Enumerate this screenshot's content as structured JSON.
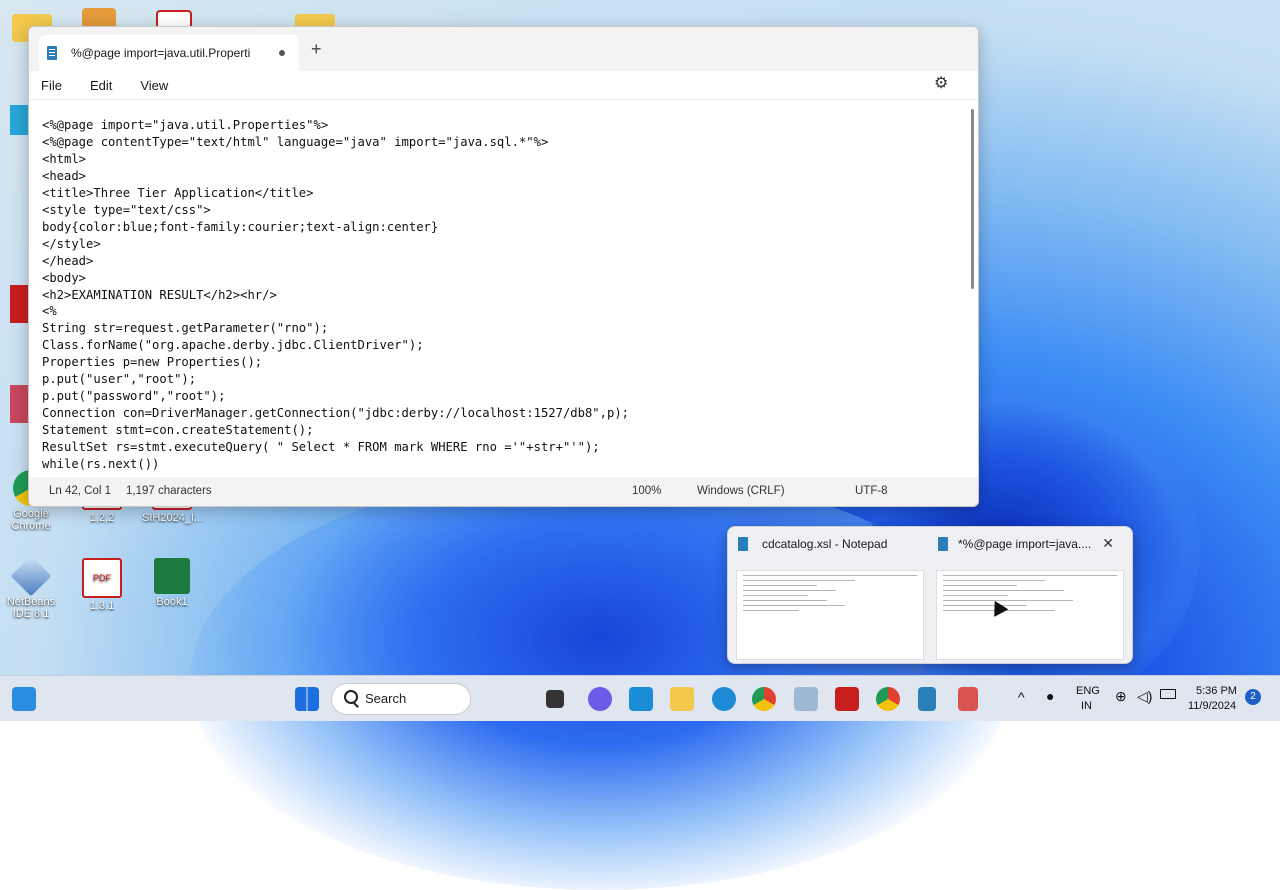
{
  "notepad": {
    "tab_title": "%@page import=java.util.Properti",
    "new_tab": "+",
    "menu": [
      "File",
      "Edit",
      "View"
    ],
    "code_lines": [
      "<%@page import=\"java.util.Properties\"%>",
      "<%@page contentType=\"text/html\" language=\"java\" import=\"java.sql.*\"%>",
      "<html>",
      "<head>",
      "<title>Three Tier Application</title>",
      "<style type=\"text/css\">",
      "body{color:blue;font-family:courier;text-align:center}",
      "</style>",
      "</head>",
      "<body>",
      "<h2>EXAMINATION RESULT</h2><hr/>",
      "<%",
      "String str=request.getParameter(\"rno\");",
      "Class.forName(\"org.apache.derby.jdbc.ClientDriver\");",
      "Properties p=new Properties();",
      "p.put(\"user\",\"root\");",
      "p.put(\"password\",\"root\");",
      "Connection con=DriverManager.getConnection(\"jdbc:derby://localhost:1527/db8\",p);",
      "Statement stmt=con.createStatement();",
      "ResultSet rs=stmt.executeQuery( \" Select * FROM mark WHERE rno ='\"+str+\"'\");",
      "while(rs.next())",
      "{"
    ],
    "status": {
      "position": "Ln 42, Col 1",
      "chars": "1,197 characters",
      "zoom": "100%",
      "eol": "Windows (CRLF)",
      "encoding": "UTF-8"
    }
  },
  "desktop_icons": [
    {
      "label": "Google Chrome",
      "color": "#e0402f",
      "icon": "chrome-icon"
    },
    {
      "label": "1,2,2",
      "color": "#c81e1e",
      "icon": "pdf-icon"
    },
    {
      "label": "SIH2024_I...",
      "color": "#c81e1e",
      "icon": "pdf-icon"
    },
    {
      "label": "NetBeans IDE 8.1",
      "color": "#4a7fc1",
      "icon": "netbeans-icon"
    },
    {
      "label": "1.3.1",
      "color": "#c81e1e",
      "icon": "pdf-icon"
    },
    {
      "label": "Book1",
      "color": "#1d7a3f",
      "icon": "excel-icon"
    }
  ],
  "preview": {
    "items": [
      {
        "title": "cdcatalog.xsl - Notepad"
      },
      {
        "title": "*%@page import=java...."
      }
    ],
    "close": "✕"
  },
  "taskbar": {
    "search_label": "Search",
    "lang_top": "ENG",
    "lang_bottom": "IN",
    "time": "5:36 PM",
    "date": "11/9/2024",
    "notifications": "2"
  }
}
